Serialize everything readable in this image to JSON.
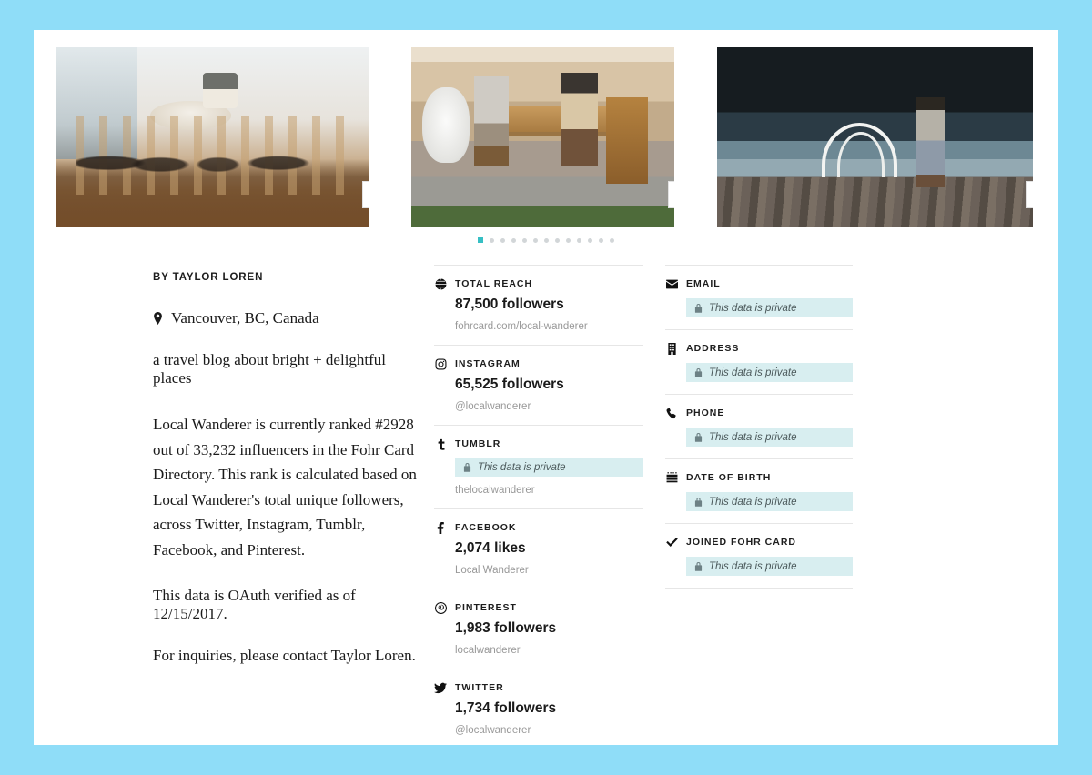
{
  "background_color": "#8fddf8",
  "card_background": "#ffffff",
  "accent_color": "#36bfc4",
  "private_field_bg": "#d8eef0",
  "carousel": {
    "slides": [
      {
        "alt": "bright cafe interior with rattan bistro chairs and wood floor",
        "link_icon": "link-icon"
      },
      {
        "alt": "two women seated at a wooden table with coffee mugs",
        "link_icon": "link-icon"
      },
      {
        "alt": "person standing on a wooden dock by dark water with white arch sculpture",
        "link_icon": "link-icon"
      }
    ],
    "dot_count": 13,
    "active_dot": 0
  },
  "profile": {
    "byline": "BY TAYLOR LOREN",
    "location_icon": "map-pin-icon",
    "location": "Vancouver, BC, Canada",
    "tagline": "a travel blog about bright + delightful places",
    "description": "Local Wanderer is currently ranked #2928 out of 33,232 influencers in the Fohr Card Directory. This rank is calculated based on Local Wanderer's total unique followers, across Twitter, Instagram, Tumblr, Facebook, and Pinterest.",
    "verified_note": "This data is OAuth verified as of 12/15/2017.",
    "inquiries": "For inquiries, please contact Taylor Loren."
  },
  "stats": [
    {
      "icon": "globe-icon",
      "label": "TOTAL REACH",
      "value": "87,500 followers",
      "sub": "fohrcard.com/local-wanderer",
      "private": false
    },
    {
      "icon": "instagram-icon",
      "label": "INSTAGRAM",
      "value": "65,525 followers",
      "sub": "@localwanderer",
      "private": false
    },
    {
      "icon": "tumblr-icon",
      "label": "TUMBLR",
      "value": "",
      "sub": "thelocalwanderer",
      "private": true,
      "private_text": "This data is private"
    },
    {
      "icon": "facebook-icon",
      "label": "FACEBOOK",
      "value": "2,074 likes",
      "sub": "Local Wanderer",
      "private": false
    },
    {
      "icon": "pinterest-icon",
      "label": "PINTEREST",
      "value": "1,983 followers",
      "sub": "localwanderer",
      "private": false
    },
    {
      "icon": "twitter-icon",
      "label": "TWITTER",
      "value": "1,734 followers",
      "sub": "@localwanderer",
      "private": false
    }
  ],
  "contact_fields": [
    {
      "icon": "envelope-icon",
      "label": "EMAIL",
      "private_text": "This data is private"
    },
    {
      "icon": "building-icon",
      "label": "ADDRESS",
      "private_text": "This data is private"
    },
    {
      "icon": "phone-icon",
      "label": "PHONE",
      "private_text": "This data is private"
    },
    {
      "icon": "birthday-cake-icon",
      "label": "DATE OF BIRTH",
      "private_text": "This data is private"
    },
    {
      "icon": "check-icon",
      "label": "JOINED FOHR CARD",
      "private_text": "This data is private"
    }
  ]
}
